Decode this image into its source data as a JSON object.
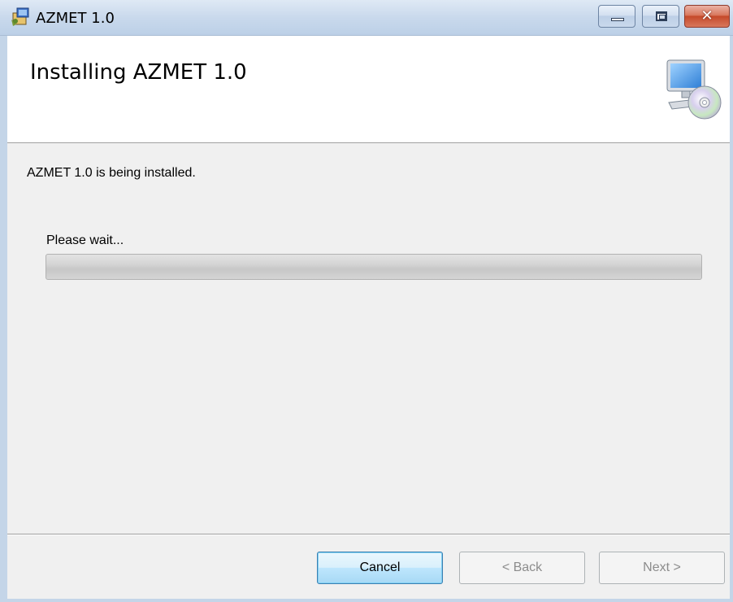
{
  "window": {
    "title": "AZMET 1.0",
    "app_icon": "installer-icon",
    "controls": {
      "minimize": "minimize-icon",
      "maximize": "maximize-icon",
      "close": "close-icon",
      "close_glyph": "✕"
    }
  },
  "header": {
    "heading": "Installing AZMET 1.0",
    "icon": "computer-cd-icon"
  },
  "body": {
    "status": "AZMET 1.0 is being installed.",
    "wait_label": "Please wait...",
    "progress_fraction": 0.0
  },
  "footer": {
    "cancel_label": "Cancel",
    "back_label": "< Back",
    "next_label": "Next >",
    "back_enabled": false,
    "next_enabled": false
  },
  "colors": {
    "frame": "#c4d5e8",
    "face": "#f0f0f0",
    "close_button": "#c54a2a",
    "focus_border": "#3c7fb1"
  }
}
